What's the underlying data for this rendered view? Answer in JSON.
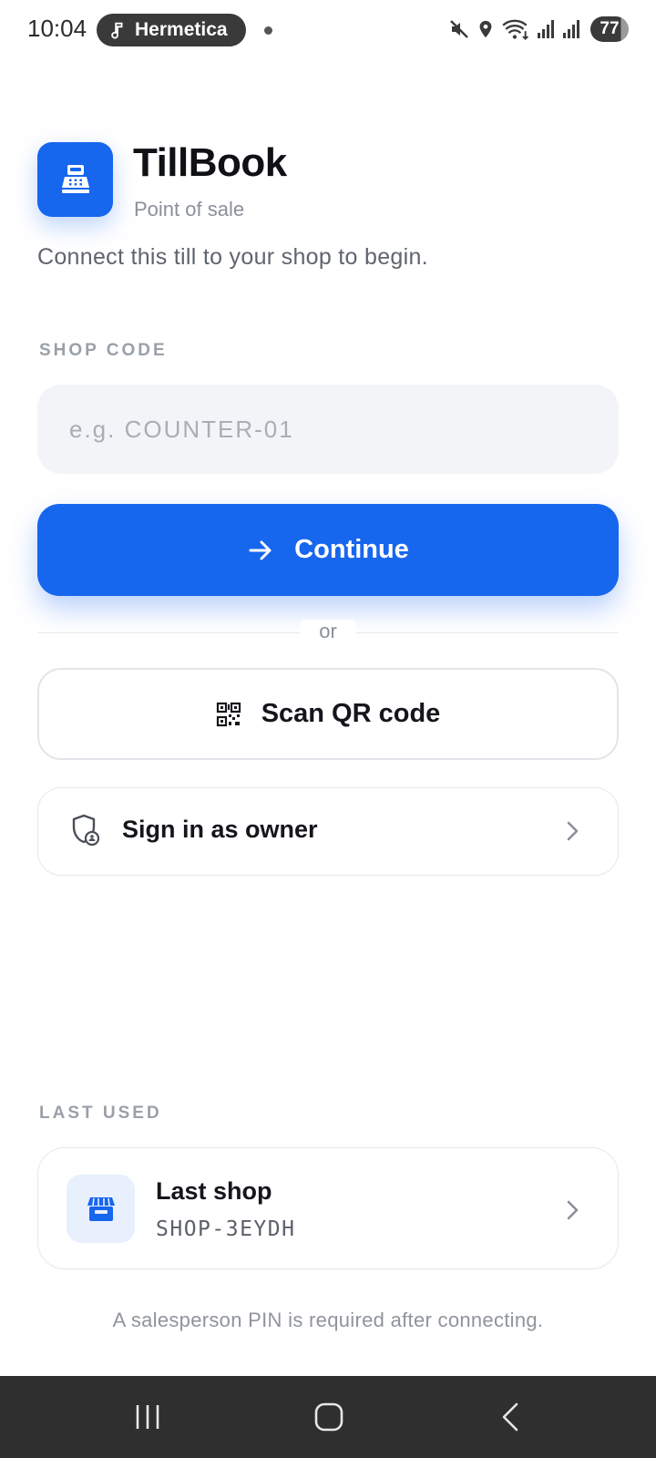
{
  "status_bar": {
    "time": "10:04",
    "media_title": "Hermetica",
    "battery": "77",
    "icons": [
      "music-note-icon",
      "mute-icon",
      "location-icon",
      "wifi-icon",
      "signal-icon",
      "signal-icon-2",
      "battery-icon"
    ]
  },
  "app": {
    "name": "TillBook",
    "subtitle": "Point of sale",
    "icon": "cash-register-icon",
    "accent": "#1766ee"
  },
  "intro_text": "Connect this till to your shop to begin.",
  "shop_code": {
    "label": "SHOP CODE",
    "placeholder": "e.g. COUNTER-01",
    "value": ""
  },
  "continue_button": {
    "label": "Continue",
    "icon": "arrow-right-icon"
  },
  "divider": "or",
  "scan_button": {
    "label": "Scan QR code",
    "icon": "qr-code-icon"
  },
  "owner_button": {
    "label": "Sign in as owner",
    "icon": "shield-user-icon"
  },
  "last_used": {
    "label": "LAST USED",
    "shop_name": "Last shop",
    "shop_code": "SHOP-3EYDH",
    "icon": "store-icon"
  },
  "footer_note": "A salesperson PIN is required after connecting.",
  "nav": [
    "recents-icon",
    "home-icon",
    "back-icon"
  ]
}
